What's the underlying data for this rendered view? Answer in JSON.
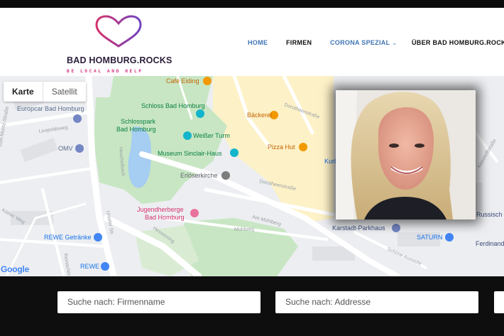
{
  "site": {
    "brand_name": "BAD HOMBURG.ROCKS",
    "brand_tagline": "BE LOCAL AND HELP",
    "colors": {
      "nav_active": "#3f74b5",
      "tagline": "#d63384",
      "logo_gradient_start": "#d6336c",
      "logo_gradient_end": "#6f42c1"
    }
  },
  "nav": {
    "items": [
      {
        "label": "HOME",
        "active": true
      },
      {
        "label": "FIRMEN",
        "active": false
      },
      {
        "label": "CORONA SPEZIAL",
        "active": false,
        "has_dropdown": true
      },
      {
        "label": "ÜBER BAD HOMBURG.ROCKS",
        "active": false
      }
    ],
    "dropdown_icon": "chevron-down-icon"
  },
  "map": {
    "tabs": [
      "Karte",
      "Satellit"
    ],
    "selected_tab": "Karte",
    "attribution": "Google",
    "pois": [
      "Café Eiding",
      "Schloss Bad Homburg",
      "Schlosspark",
      "Bad Homburg",
      "Weißer Turm",
      "Museum Sinclair-Haus",
      "Erlöserkirche",
      "Bäckerei",
      "Pizza Hut",
      "Kurl",
      "Europcar Bad Homburg",
      "OMV",
      "Jugendherberge",
      "Bad Homburg",
      "REWE Getränke",
      "REWE",
      "Karstadt-Parkhaus",
      "SATURN",
      "Russisch",
      "Ferdinand"
    ],
    "streets": [
      "Leopoldsweg",
      "Heuchelbach",
      "Urseler Str.",
      "Hessenring",
      "Mühlweg",
      "Am Mühlberg",
      "Dorotheenstraße",
      "Dorotheenstraße",
      "Schöne Aussicht",
      "Kisseleffstraße",
      "Kölner Weg",
      "Reinacher Weg",
      "Kurt-Moritz-Straße"
    ]
  },
  "photo": {
    "alt": "Portrait of a woman with blonde hair"
  },
  "search": {
    "company_placeholder": "Suche nach: Firmenname",
    "address_placeholder": "Suche nach: Addresse"
  }
}
